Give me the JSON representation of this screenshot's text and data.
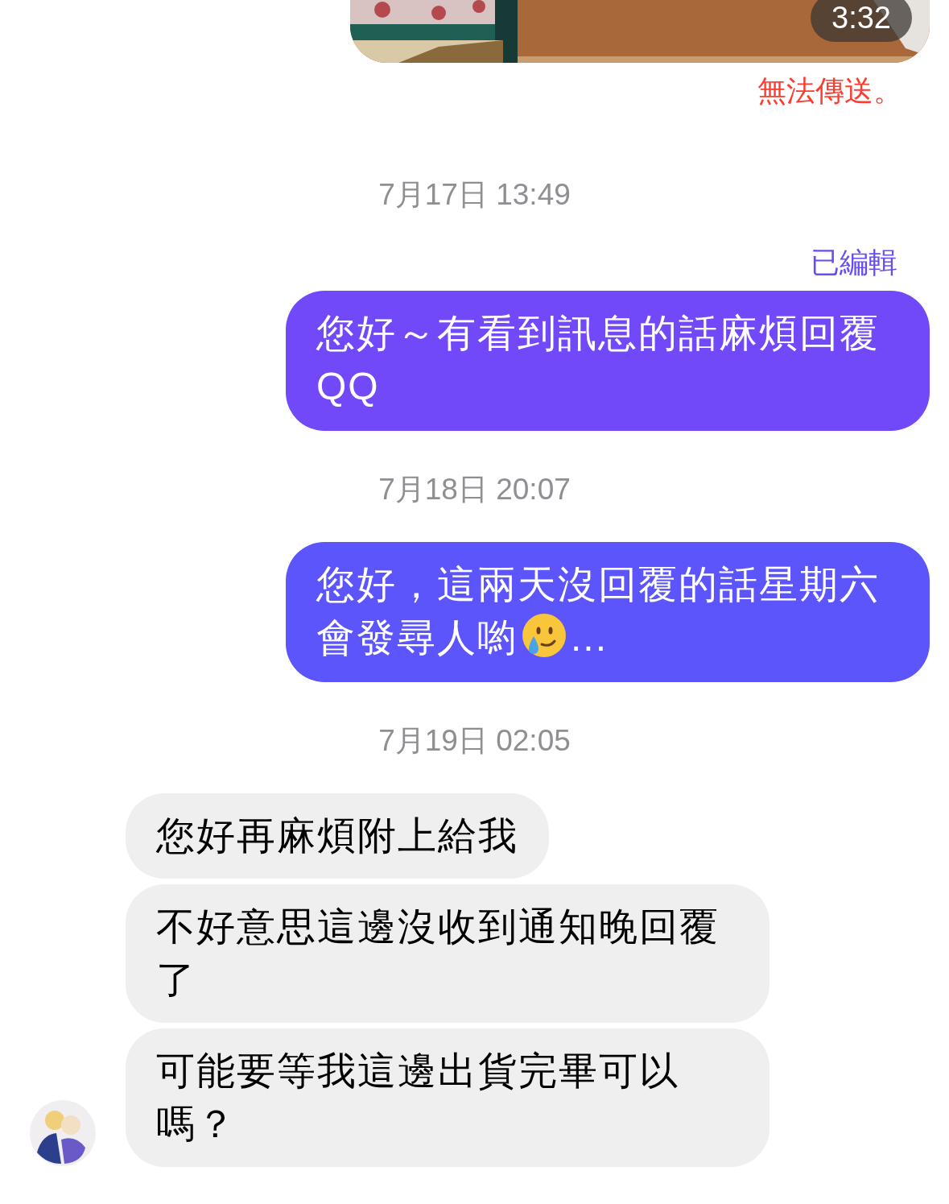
{
  "video": {
    "kind": "picture",
    "duration": "3:32",
    "error": "無法傳送。"
  },
  "blocks": [
    {
      "kind": "timestamp",
      "text": "7月17日 13:49"
    },
    {
      "kind": "outgoing",
      "edited_label": "已編輯",
      "color": "#7249f8",
      "parts": [
        {
          "kind": "text",
          "text": "您好～有看到訊息的話麻煩回覆QQ"
        }
      ]
    },
    {
      "kind": "timestamp",
      "text": "7月18日 20:07"
    },
    {
      "kind": "outgoing",
      "color": "#5b55fb",
      "parts": [
        {
          "kind": "text",
          "text": "您好，這兩天沒回覆的話星期六會發尋人喲"
        },
        {
          "kind": "emoji"
        },
        {
          "kind": "text",
          "text": "..."
        }
      ]
    },
    {
      "kind": "timestamp",
      "text": "7月19日 02:05"
    },
    {
      "kind": "incoming",
      "messages": [
        "您好再麻煩附上給我",
        "不好意思這邊沒收到通知晚回覆了",
        "可能要等我這邊出貨完畢可以嗎？"
      ]
    }
  ]
}
